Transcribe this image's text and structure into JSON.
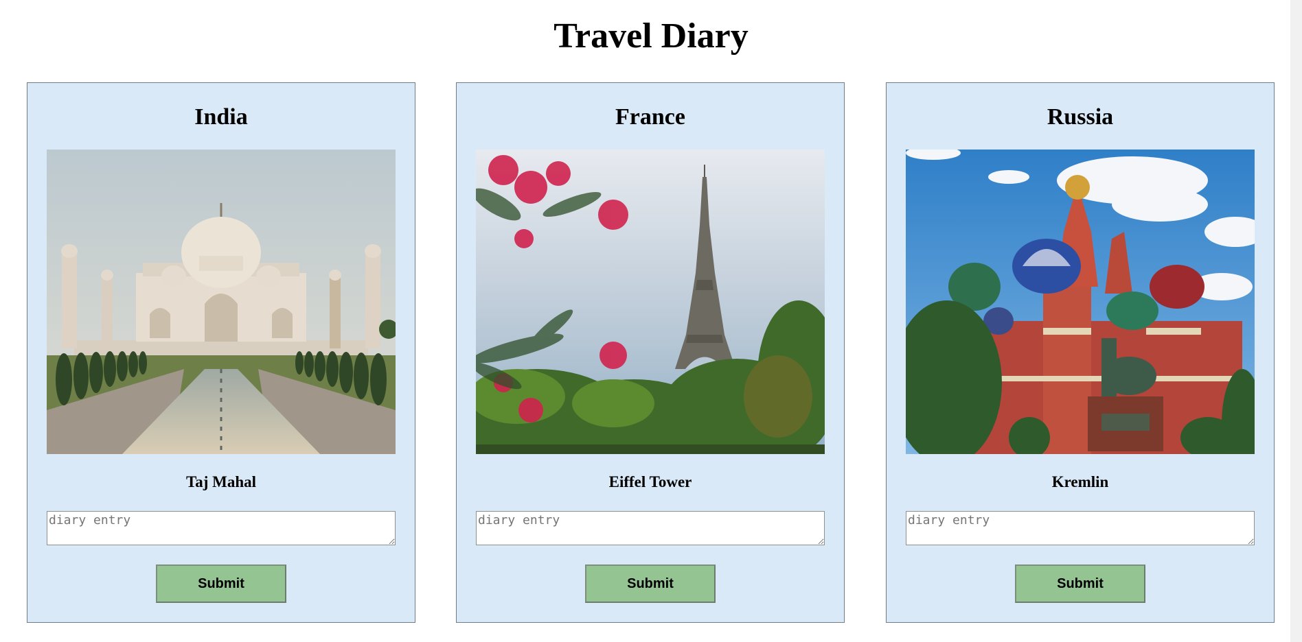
{
  "page": {
    "title": "Travel Diary"
  },
  "cards": [
    {
      "country": "India",
      "landmark": "Taj Mahal",
      "photo_subject": "taj-mahal-photo",
      "diary_placeholder": "diary entry",
      "submit_label": "Submit"
    },
    {
      "country": "France",
      "landmark": "Eiffel Tower",
      "photo_subject": "eiffel-tower-photo",
      "diary_placeholder": "diary entry",
      "submit_label": "Submit"
    },
    {
      "country": "Russia",
      "landmark": "Kremlin",
      "photo_subject": "kremlin-photo",
      "diary_placeholder": "diary entry",
      "submit_label": "Submit"
    }
  ],
  "colors": {
    "card_background": "#d9e9f7",
    "card_border": "#6e7c87",
    "submit_background": "#93c492"
  }
}
